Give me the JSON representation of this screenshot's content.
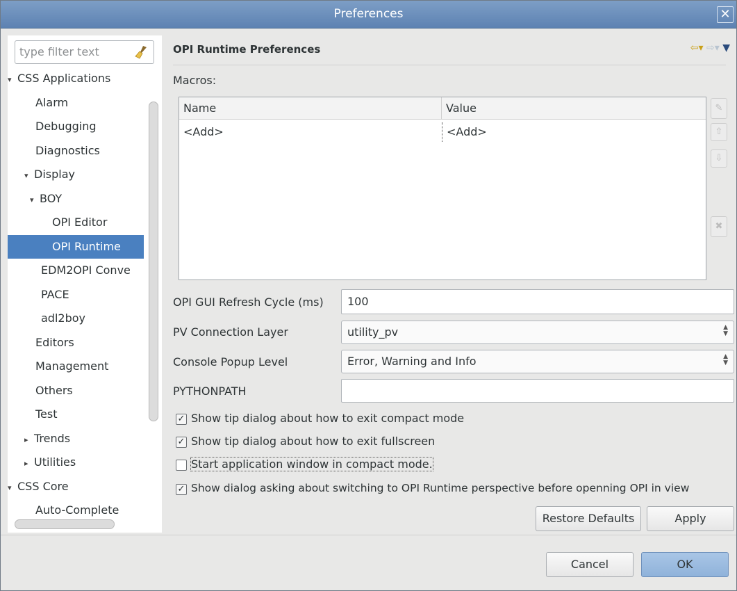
{
  "window": {
    "title": "Preferences",
    "close_glyph": "✕"
  },
  "filter": {
    "placeholder": "type filter text",
    "icon": "broom-icon"
  },
  "tree": {
    "items": [
      {
        "label": "CSS Applications",
        "level": 0,
        "arrow": "▾"
      },
      {
        "label": "Alarm",
        "level": 1,
        "arrow": ""
      },
      {
        "label": "Debugging",
        "level": 1,
        "arrow": ""
      },
      {
        "label": "Diagnostics",
        "level": 1,
        "arrow": ""
      },
      {
        "label": "Display",
        "level": 1,
        "arrow": "▾"
      },
      {
        "label": "BOY",
        "level": 2,
        "arrow": "▾"
      },
      {
        "label": "OPI Editor",
        "level": 3,
        "arrow": ""
      },
      {
        "label": "OPI Runtime",
        "level": 3,
        "arrow": "",
        "selected": true
      },
      {
        "label": "EDM2OPI Conve",
        "level": 2,
        "arrow": ""
      },
      {
        "label": "PACE",
        "level": 2,
        "arrow": ""
      },
      {
        "label": "adl2boy",
        "level": 2,
        "arrow": ""
      },
      {
        "label": "Editors",
        "level": 1,
        "arrow": ""
      },
      {
        "label": "Management",
        "level": 1,
        "arrow": ""
      },
      {
        "label": "Others",
        "level": 1,
        "arrow": ""
      },
      {
        "label": "Test",
        "level": 1,
        "arrow": ""
      },
      {
        "label": "Trends",
        "level": 1,
        "arrow": "▸"
      },
      {
        "label": "Utilities",
        "level": 1,
        "arrow": "▸"
      },
      {
        "label": "CSS Core",
        "level": 0,
        "arrow": "▾"
      },
      {
        "label": "Auto-Complete",
        "level": 1,
        "arrow": ""
      }
    ]
  },
  "page": {
    "heading": "OPI Runtime Preferences",
    "macros_label": "Macros:",
    "table": {
      "columns": [
        "Name",
        "Value"
      ],
      "rows": [
        [
          "<Add>",
          "<Add>"
        ]
      ]
    },
    "refresh_label": "OPI GUI Refresh Cycle (ms)",
    "refresh_value": "100",
    "pv_label": "PV Connection Layer",
    "pv_value": "utility_pv",
    "console_label": "Console Popup Level",
    "console_value": "Error, Warning and Info",
    "python_label": "PYTHONPATH",
    "python_value": "",
    "checkboxes": [
      {
        "label": "Show tip dialog about how to exit compact mode",
        "checked": true
      },
      {
        "label": "Show tip dialog about how to exit fullscreen",
        "checked": true
      },
      {
        "label": "Start application window in compact mode.",
        "checked": false
      },
      {
        "label": "Show dialog asking about switching to OPI Runtime perspective before openning OPI in view",
        "checked": true
      }
    ],
    "restore_label": "Restore Defaults",
    "apply_label": "Apply"
  },
  "footer": {
    "cancel_label": "Cancel",
    "ok_label": "OK"
  }
}
